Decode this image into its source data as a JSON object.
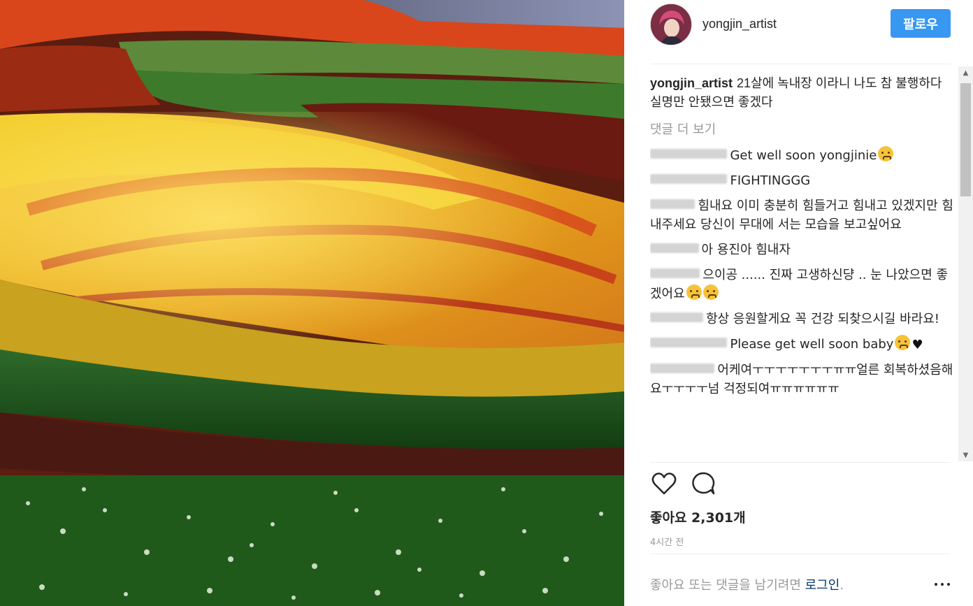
{
  "post": {
    "username": "yongjin_artist",
    "follow_label": "팔로우",
    "caption_author": "yongjin_artist",
    "caption_text": "21살에 녹내장 이라니 나도 참 불행하다 실명만 안됐으면 좋겠다",
    "more_comments_label": "댓글 더 보기",
    "likes_text": "좋아요 2,301개",
    "timestamp": "4시간 전",
    "footer_prompt": "좋아요 또는 댓글을 남기려면",
    "login_label": "로그인",
    "footer_period": "."
  },
  "comments": [
    {
      "user": "anbuonemenerel",
      "text": "Get well soon yongjinie",
      "emoji": [
        "crying-face"
      ]
    },
    {
      "user": "anbuonemenerel",
      "text": "FIGHTINGGG",
      "emoji": []
    },
    {
      "user": "phyyy124",
      "text": "힘내요 이미 충분히 힘들거고 힘내고 있겠지만 힘내주세요 당신이 무대에 서는 모습을 보고싶어요",
      "emoji": []
    },
    {
      "user": "hifellou_all",
      "text": "아 용진아 힘내자",
      "emoji": []
    },
    {
      "user": "hh_poll__jh",
      "text": "으이공 ...... 진짜 고생하신댱 .. 눈 나았으면 좋겠어요",
      "emoji": [
        "sad-face",
        "sad-face"
      ]
    },
    {
      "user": "cmilyu8888",
      "text": "항상 응원할게요 꼭 건강 되찾으시길 바라요!",
      "emoji": []
    },
    {
      "user": "lonenapagaparm",
      "text": "Please get well soon baby",
      "emoji": [
        "crying-face",
        "black-heart"
      ]
    },
    {
      "user": "amenalum_11",
      "text": "어케여ㅜㅜㅜㅜㅜㅜㅜㅠㅠ얼른 회복하셨음해요ㅜㅜㅜㅜ넘 걱정되여ㅠㅠㅠㅠㅠㅠ",
      "emoji": []
    }
  ],
  "icons": {
    "like": "heart-outline-icon",
    "comment": "comment-bubble-icon",
    "more": "more-options-icon"
  },
  "colors": {
    "follow_button": "#3897f0",
    "login_link": "#003569",
    "muted_text": "#999999"
  }
}
